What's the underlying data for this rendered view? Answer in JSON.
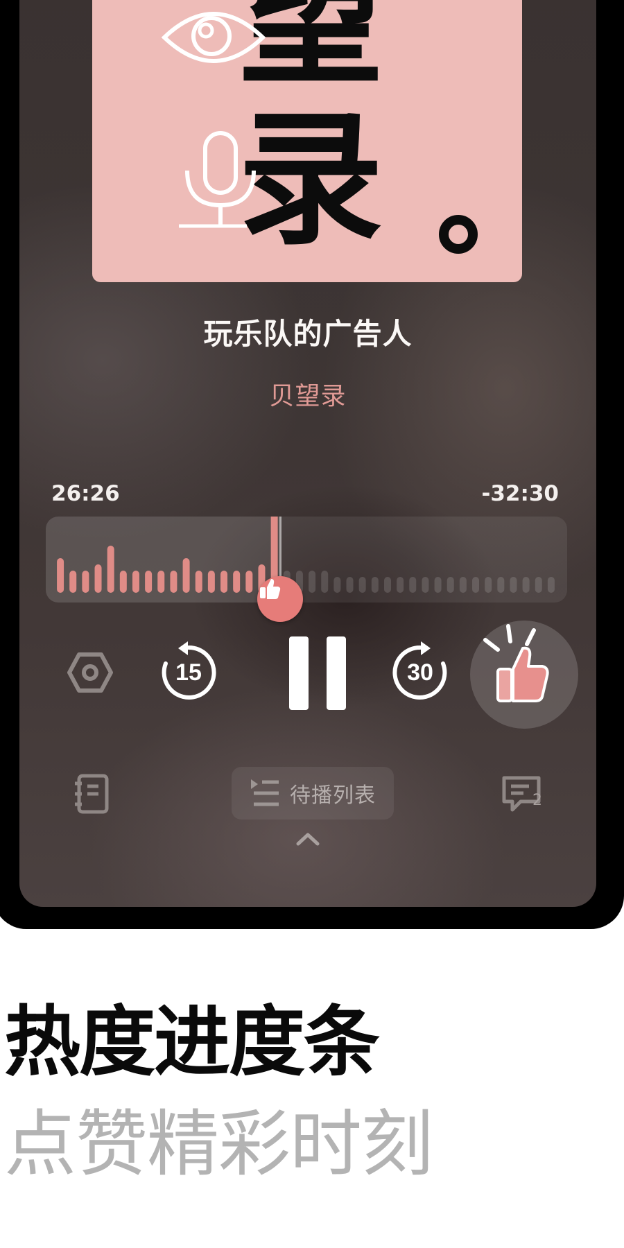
{
  "cover": {
    "char_top": "望",
    "char_bottom": "录",
    "dot": "。"
  },
  "episode": {
    "title": "玩乐队的广告人",
    "podcast": "贝望录"
  },
  "progress": {
    "elapsed": "26:26",
    "remaining": "-32:30",
    "played_fraction": 0.449
  },
  "heatmap": {
    "bars_total": 40,
    "played_color": "#e08c87",
    "unplayed_color": "rgba(255,255,255,0.14)",
    "heights": [
      4,
      2,
      2,
      3,
      6,
      2,
      2,
      2,
      2,
      2,
      4,
      2,
      2,
      2,
      2,
      2,
      3,
      12,
      2,
      2,
      2,
      2,
      1,
      1,
      1,
      1,
      1,
      1,
      1,
      1,
      1,
      1,
      1,
      1,
      1,
      1,
      1,
      1,
      1,
      1
    ],
    "peak_index": 17
  },
  "controls": {
    "rewind_seconds": "15",
    "forward_seconds": "30"
  },
  "bottom_bar": {
    "queue_label": "待播列表",
    "comment_count": "2"
  },
  "promo": {
    "headline": "热度进度条",
    "tagline": "点赞精彩时刻"
  },
  "colors": {
    "accent": "#e67c79",
    "cover_bg": "#eebcb8",
    "subtitle": "#e09a95"
  }
}
